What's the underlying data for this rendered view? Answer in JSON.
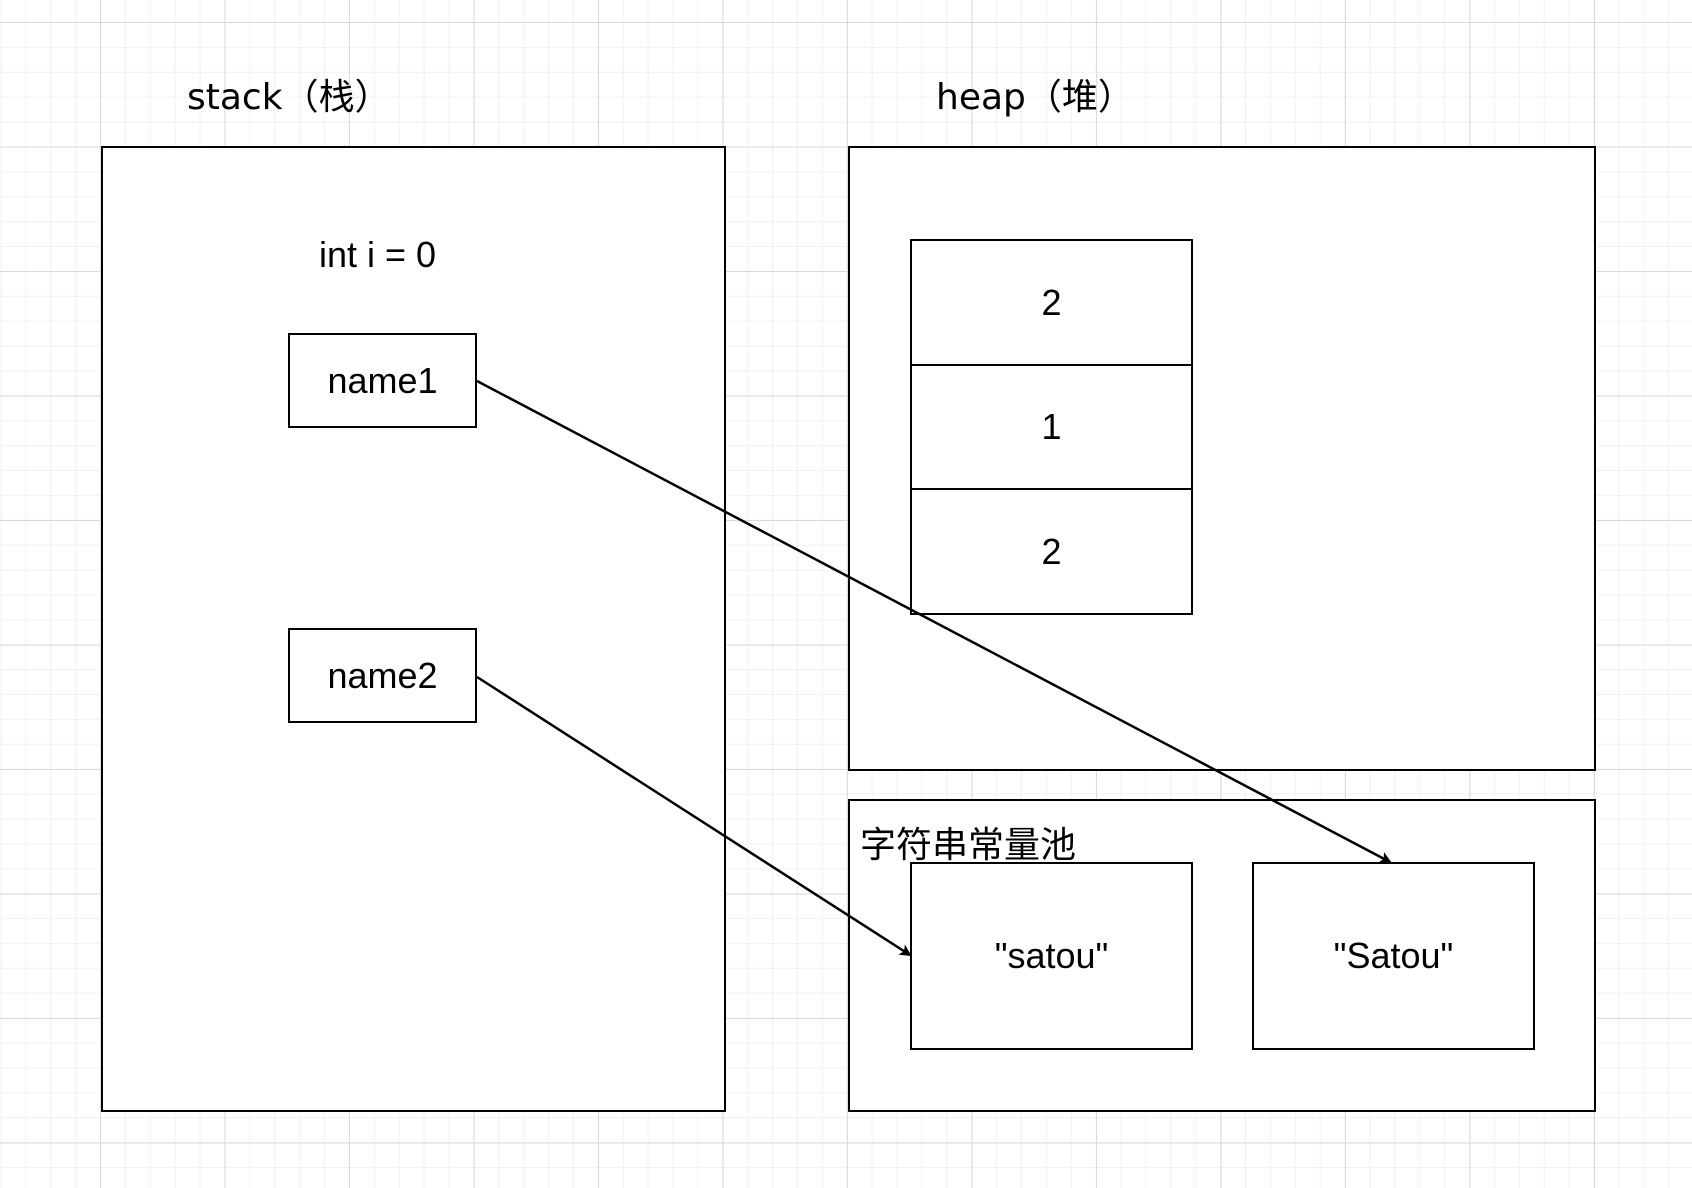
{
  "stack": {
    "title": "stack（栈）",
    "int_decl": "int i = 0",
    "name1": "name1",
    "name2": "name2"
  },
  "heap": {
    "title": "heap（堆）",
    "array_cells": [
      "2",
      "1",
      "2"
    ]
  },
  "string_pool": {
    "title": "字符串常量池",
    "literal_lower": "\"satou\"",
    "literal_upper": "\"Satou\""
  },
  "arrows": [
    {
      "from": "name1",
      "to": "\"Satou\""
    },
    {
      "from": "name2",
      "to": "\"satou\""
    }
  ],
  "colors": {
    "stroke": "#000000",
    "background": "#ffffff",
    "grid_major": "#dadada",
    "grid_minor": "#f0f0f0"
  }
}
